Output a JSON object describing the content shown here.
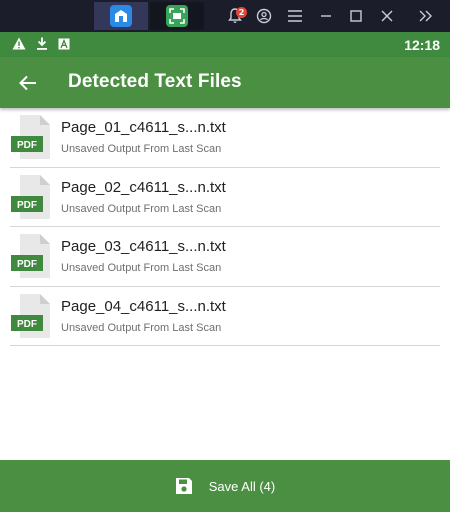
{
  "emulator": {
    "tabs": [
      {
        "icon": "store-icon"
      },
      {
        "icon": "scanner-app-icon"
      }
    ],
    "notification_count": "2",
    "controls": [
      "notifications-icon",
      "account-icon",
      "menu-icon",
      "minimize-icon",
      "maximize-icon",
      "close-icon",
      "expand-sidebar-icon"
    ]
  },
  "status_bar": {
    "icons": [
      "warning-icon",
      "download-icon",
      "font-icon"
    ],
    "time": "12:18"
  },
  "app_bar": {
    "title": "Detected Text Files",
    "back_icon": "arrow-left-icon"
  },
  "files": [
    {
      "name": "Page_01_c4611_s...n.txt",
      "subtitle": "Unsaved Output From Last Scan",
      "badge": "PDF"
    },
    {
      "name": "Page_02_c4611_s...n.txt",
      "subtitle": "Unsaved Output From Last Scan",
      "badge": "PDF"
    },
    {
      "name": "Page_03_c4611_s...n.txt",
      "subtitle": "Unsaved Output From Last Scan",
      "badge": "PDF"
    },
    {
      "name": "Page_04_c4611_s...n.txt",
      "subtitle": "Unsaved Output From Last Scan",
      "badge": "PDF"
    }
  ],
  "save_bar": {
    "label": "Save All (4)",
    "icon": "floppy-disk-icon"
  },
  "colors": {
    "primary": "#4b8f43",
    "status_bar": "#3f8a3f",
    "pdf_badge": "#3f8a3f"
  }
}
